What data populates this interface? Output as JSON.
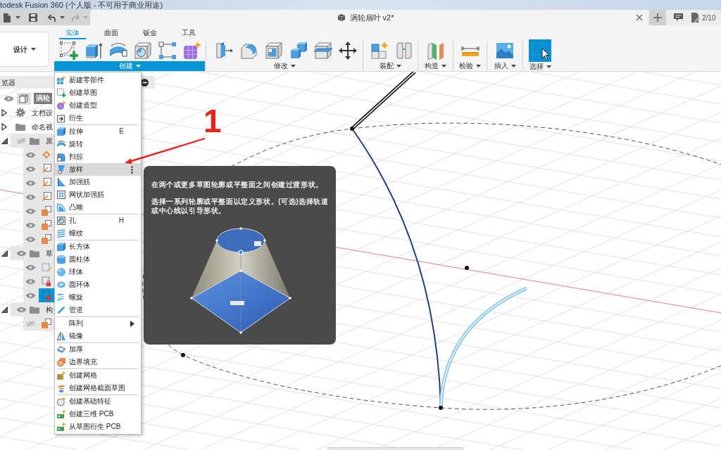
{
  "title_bar": {
    "title": "todesk Fusion 360 (个人版 - 不可用于商业用途)"
  },
  "document_tab": {
    "title": "涡轮扇叶 v2*"
  },
  "jobs": {
    "count": "2/10"
  },
  "workspace": {
    "label": "设计"
  },
  "ribbon_tabs": [
    {
      "label": "实体",
      "selected": true
    },
    {
      "label": "曲面",
      "selected": false
    },
    {
      "label": "钣金",
      "selected": false
    },
    {
      "label": "工具",
      "selected": false
    }
  ],
  "tool_groups": [
    {
      "kind": "create",
      "label": "创建",
      "open": true,
      "active": false
    },
    {
      "kind": "modify",
      "label": "修改",
      "open": false,
      "active": false
    },
    {
      "kind": "assemble",
      "label": "装配",
      "open": false,
      "active": false
    },
    {
      "kind": "construct",
      "label": "构造",
      "open": false,
      "active": false
    },
    {
      "kind": "inspect",
      "label": "检验",
      "open": false,
      "active": false
    },
    {
      "kind": "insert",
      "label": "插入",
      "open": false,
      "active": false
    },
    {
      "kind": "select",
      "label": "选择",
      "open": false,
      "active": true
    }
  ],
  "browser": {
    "title": "览器",
    "tree": [
      {
        "kind": "component",
        "label": "涡轮",
        "visible": true,
        "active": true,
        "children": [
          {
            "kind": "settings",
            "label": "文档设",
            "expanded": false
          },
          {
            "kind": "views",
            "label": "命名视",
            "expanded": false
          },
          {
            "kind": "folder",
            "label": "原",
            "expanded": true,
            "visible": false,
            "children": [
              {
                "kind": "point",
                "visible": true,
                "selected": false
              },
              {
                "kind": "axis",
                "visible": true,
                "selected": false
              },
              {
                "kind": "axis",
                "visible": true,
                "selected": false
              },
              {
                "kind": "axis",
                "visible": true,
                "selected": false
              },
              {
                "kind": "plane",
                "visible": true,
                "selected": false
              },
              {
                "kind": "plane",
                "visible": true,
                "selected": false
              },
              {
                "kind": "plane",
                "visible": true,
                "selected": false
              }
            ]
          },
          {
            "kind": "folder",
            "label": "草",
            "expanded": true,
            "visible": true,
            "children": [
              {
                "kind": "sketch",
                "visible": true,
                "locked": false,
                "selected": false
              },
              {
                "kind": "sketch",
                "visible": true,
                "locked": true,
                "selected": false
              },
              {
                "kind": "sketch",
                "visible": true,
                "locked": true,
                "selected": true
              }
            ]
          },
          {
            "kind": "folder",
            "label": "构",
            "expanded": true,
            "visible": true,
            "children": [
              {
                "kind": "plane",
                "visible": false,
                "selected": false
              }
            ]
          }
        ]
      }
    ]
  },
  "create_menu": {
    "sections": [
      [
        {
          "kind": "component",
          "label": "新建零部件",
          "highlighted": false
        },
        {
          "kind": "sketch",
          "label": "创建草图",
          "highlighted": false
        },
        {
          "kind": "form",
          "label": "创建造型",
          "highlighted": false
        },
        {
          "kind": "derive",
          "label": "衍生",
          "highlighted": false
        }
      ],
      [
        {
          "kind": "extrude",
          "label": "拉伸",
          "shortcut": "E",
          "highlighted": false
        },
        {
          "kind": "revolve",
          "label": "旋转",
          "highlighted": false
        },
        {
          "kind": "sweep",
          "label": "扫掠",
          "highlighted": false
        },
        {
          "kind": "loft",
          "label": "放样",
          "highlighted": true
        },
        {
          "kind": "rib",
          "label": "加强筋",
          "highlighted": false
        },
        {
          "kind": "web",
          "label": "网状加强筋",
          "highlighted": false
        },
        {
          "kind": "emboss",
          "label": "凸雕",
          "highlighted": false
        }
      ],
      [
        {
          "kind": "hole",
          "label": "孔",
          "shortcut": "H",
          "highlighted": false
        },
        {
          "kind": "thread",
          "label": "螺纹",
          "highlighted": false
        }
      ],
      [
        {
          "kind": "box",
          "label": "长方体",
          "highlighted": false
        },
        {
          "kind": "cylinder",
          "label": "圆柱体",
          "highlighted": false
        },
        {
          "kind": "sphere",
          "label": "球体",
          "highlighted": false
        },
        {
          "kind": "torus",
          "label": "圆环体",
          "highlighted": false
        },
        {
          "kind": "coil",
          "label": "螺旋",
          "highlighted": false
        },
        {
          "kind": "pipe",
          "label": "管道",
          "highlighted": false
        }
      ],
      [
        {
          "kind": "pattern",
          "label": "阵列",
          "submenu": true,
          "highlighted": false
        },
        {
          "kind": "mirror",
          "label": "镜像",
          "highlighted": false
        }
      ],
      [
        {
          "kind": "thicken",
          "label": "加厚",
          "highlighted": false
        },
        {
          "kind": "boundaryfill",
          "label": "边界填充",
          "highlighted": false
        }
      ],
      [
        {
          "kind": "mesh",
          "label": "创建网格",
          "highlighted": false
        },
        {
          "kind": "meshsection",
          "label": "创建网格截面草图",
          "highlighted": false
        }
      ],
      [
        {
          "kind": "basefeature",
          "label": "创建基础特征",
          "highlighted": false
        },
        {
          "kind": "pcb3d",
          "label": "创建三维 PCB",
          "highlighted": false
        },
        {
          "kind": "pcbderive",
          "label": "从草图衍生 PCB",
          "highlighted": false
        }
      ]
    ]
  },
  "tooltip": {
    "paragraphs": [
      "在两个或更多草图轮廓或平整面之间创建过渡形状。",
      "选择一系列轮廓或平整面以定义形状。(可选)选择轨道或中心线以引导形状。"
    ]
  },
  "annotation": {
    "label": "1"
  }
}
